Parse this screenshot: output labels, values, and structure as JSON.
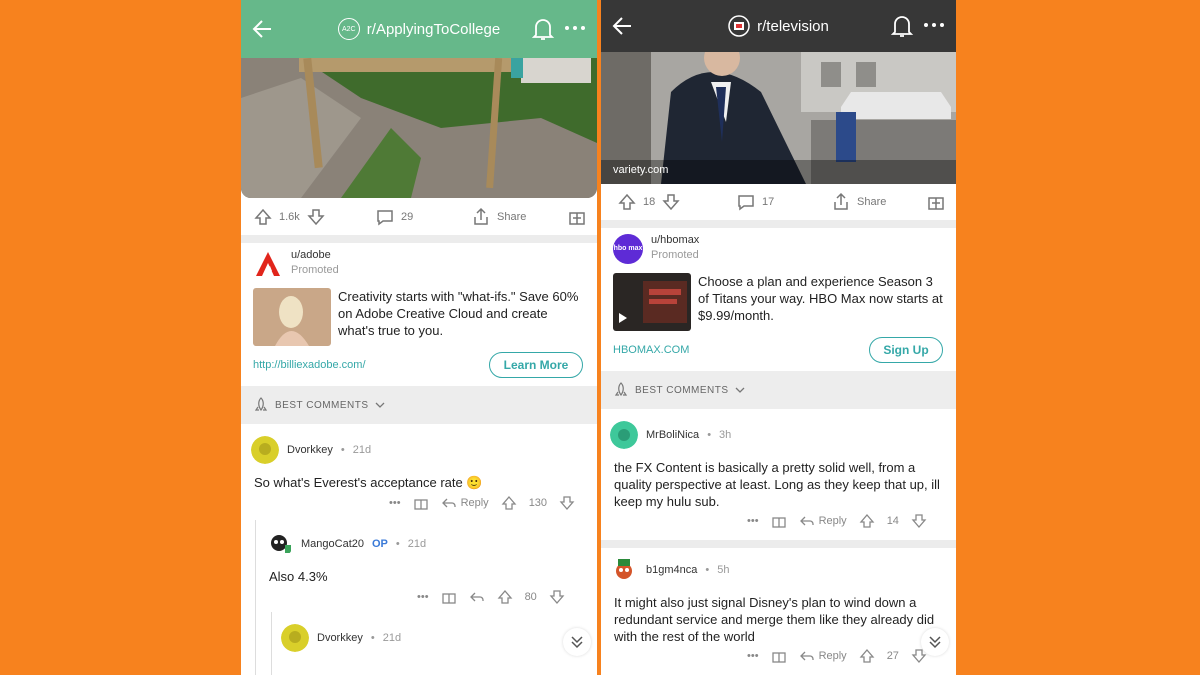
{
  "left": {
    "subreddit": "r/ApplyingToCollege",
    "sub_badge": "A2C",
    "post": {
      "upvotes": "1.6k",
      "comments": "29",
      "share_label": "Share"
    },
    "ad": {
      "user": "u/adobe",
      "promoted": "Promoted",
      "text": "Creativity starts with \"what-ifs.\" Save 60% on Adobe Creative Cloud and create what's true to you.",
      "link": "http://billiexadobe.com/",
      "button": "Learn More"
    },
    "sort_label": "BEST COMMENTS",
    "comments": [
      {
        "user": "Dvorkkey",
        "time": "21d",
        "text": "So what's Everest's acceptance rate 🙂",
        "reply": "Reply",
        "votes": "130"
      },
      {
        "user": "MangoCat20",
        "op": "OP",
        "time": "21d",
        "text": "Also 4.3%",
        "votes": "80"
      },
      {
        "user": "Dvorkkey",
        "time": "21d"
      }
    ]
  },
  "right": {
    "subreddit": "r/television",
    "caption": "variety.com",
    "post": {
      "upvotes": "18",
      "comments": "17",
      "share_label": "Share"
    },
    "ad": {
      "user": "u/hbomax",
      "promoted": "Promoted",
      "logo_text": "hbo max",
      "text": "Choose a plan and experience Season 3 of Titans your way. HBO Max now starts at $9.99/month.",
      "link": "HBOMAX.COM",
      "button": "Sign Up"
    },
    "sort_label": "BEST COMMENTS",
    "comments": [
      {
        "user": "MrBoliNica",
        "time": "3h",
        "text": "the FX Content is basically a pretty solid well, from a quality perspective at least. Long as they keep that up, ill keep my hulu sub.",
        "reply": "Reply",
        "votes": "14"
      },
      {
        "user": "b1gm4nca",
        "time": "5h",
        "text": "It might also just signal Disney's plan to wind down a redundant service and merge them like they already did with the rest of the world",
        "reply": "Reply",
        "votes": "27"
      }
    ]
  },
  "colors": {
    "background": "#f7821e",
    "left_header": "#66b88a",
    "right_header": "#373737",
    "accent": "#35a8a8"
  }
}
